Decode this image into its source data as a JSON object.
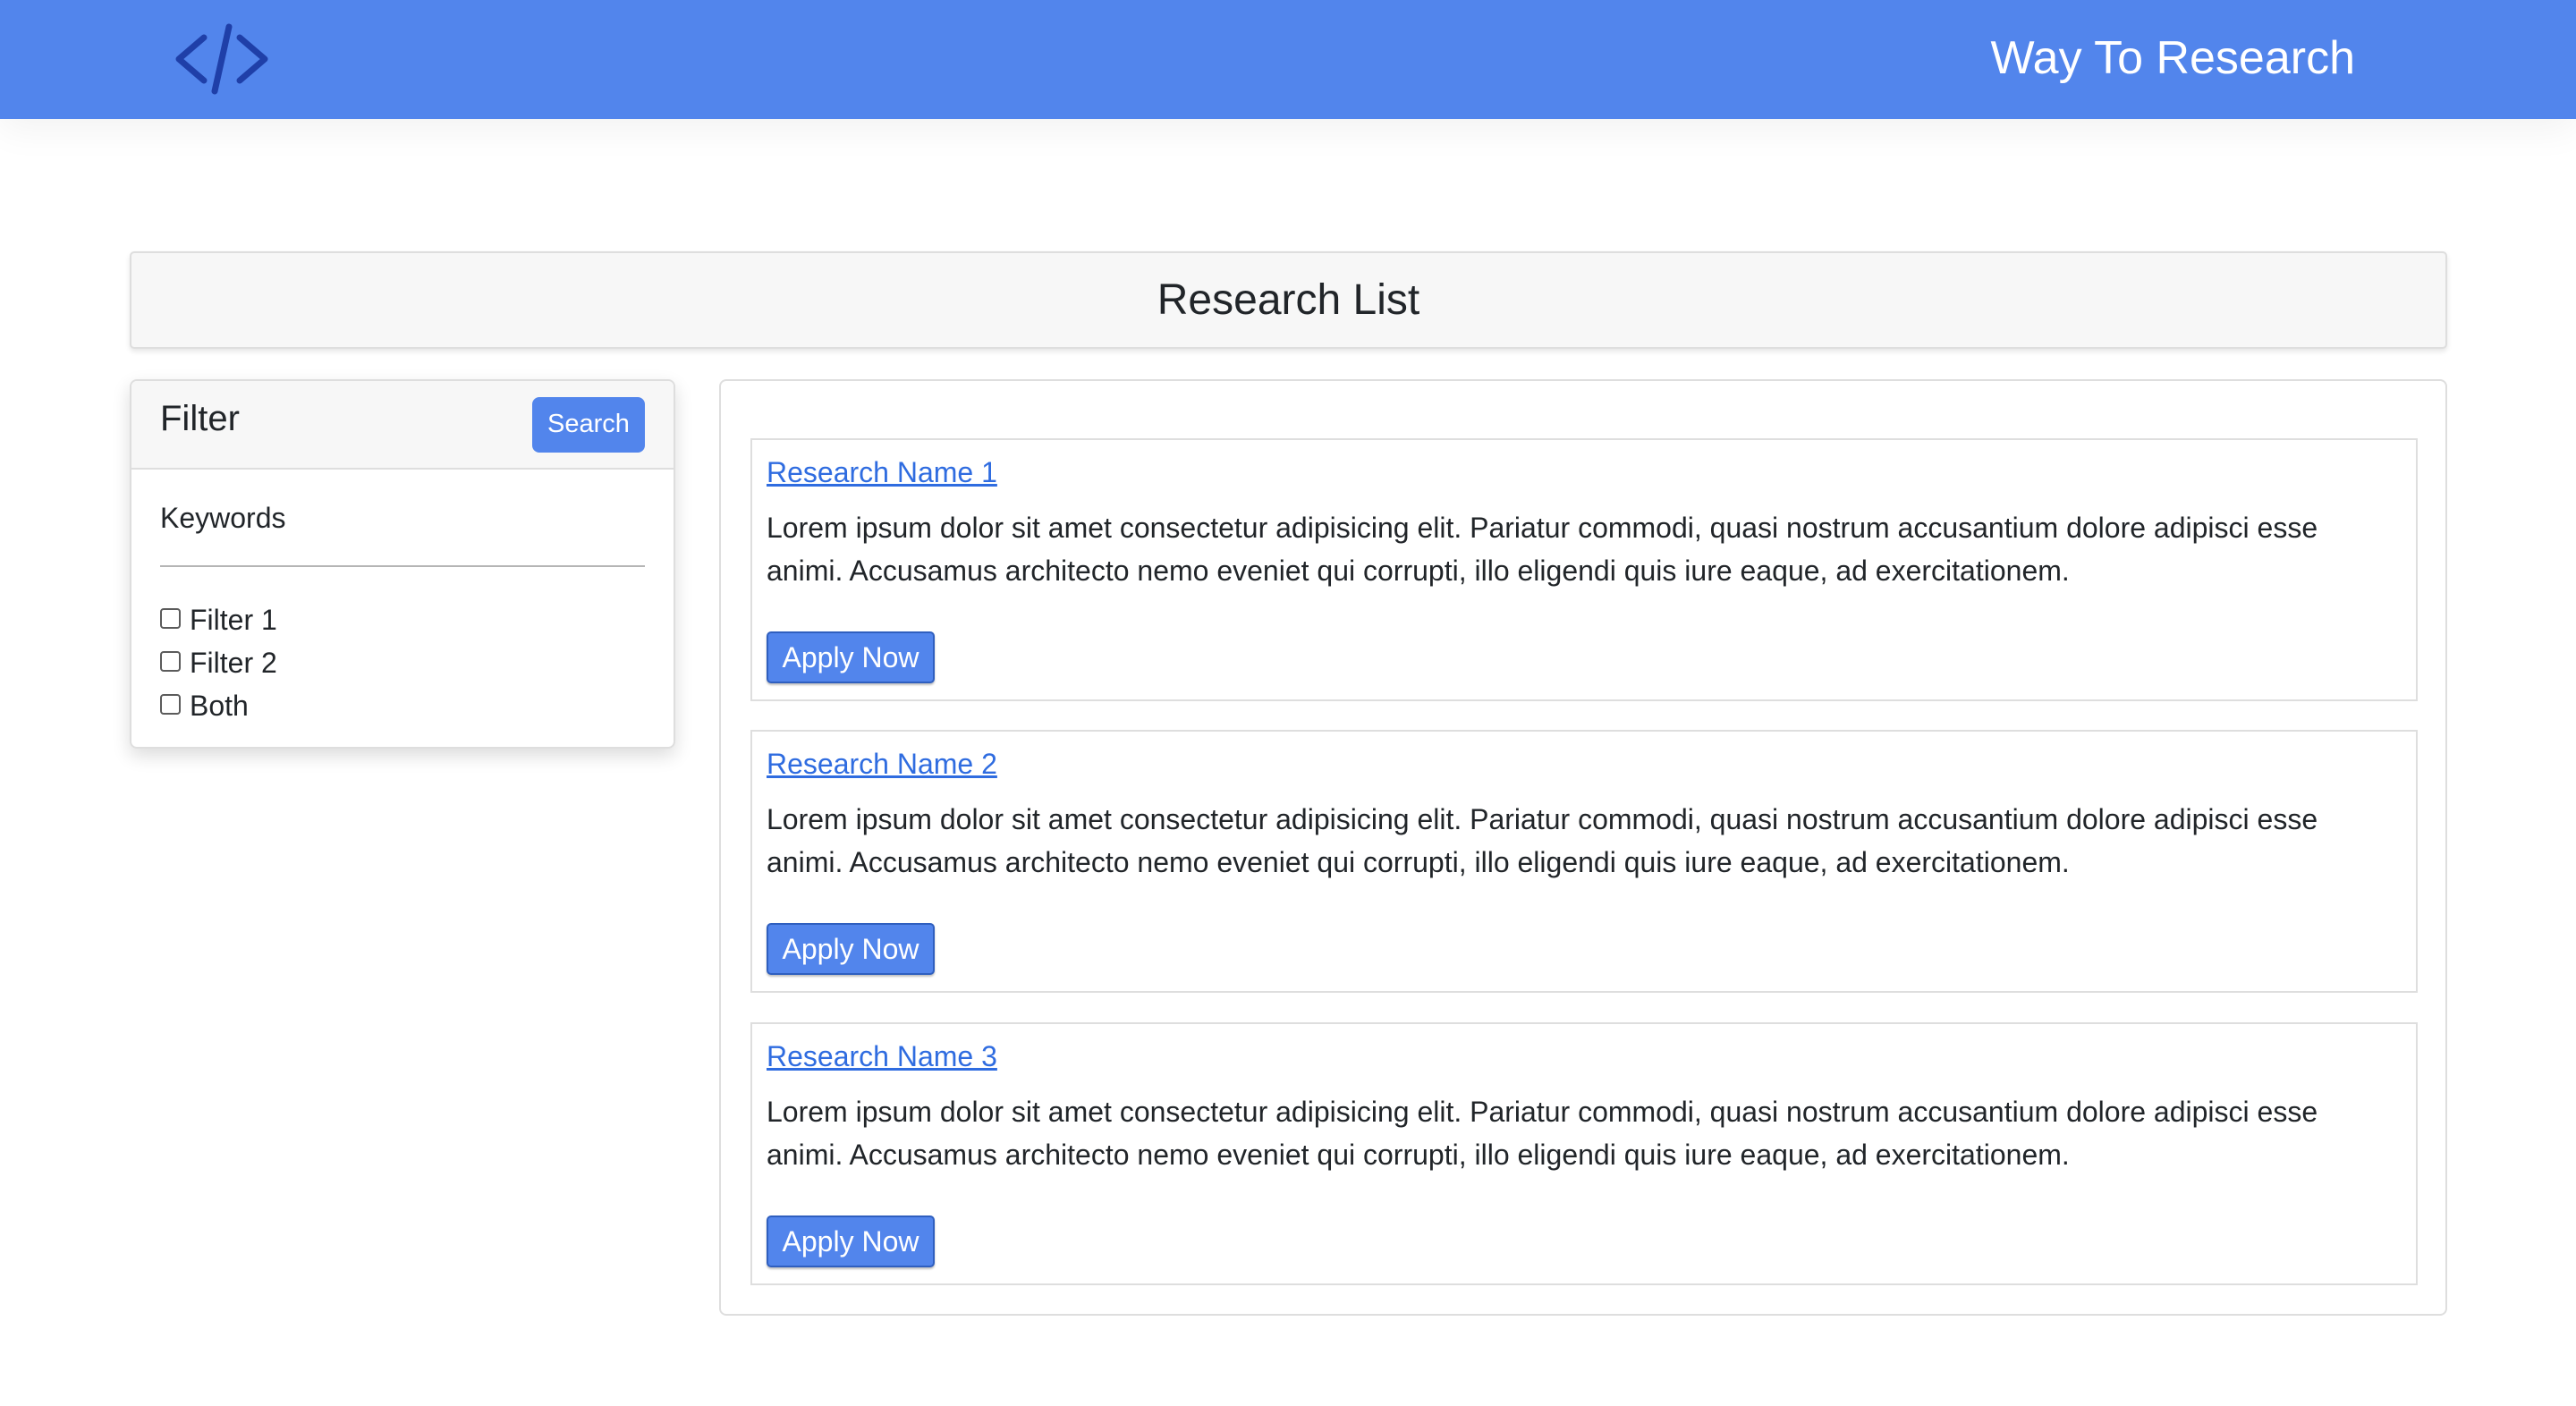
{
  "header": {
    "logo_icon": "code-icon",
    "brand": "Way To Research",
    "colors": {
      "background": "#5285ec",
      "logo": "#1f3fa8",
      "text": "#ffffff"
    }
  },
  "page": {
    "title": "Research List"
  },
  "filter": {
    "title": "Filter",
    "search_label": "Search",
    "keywords_label": "Keywords",
    "options": [
      {
        "label": "Filter 1",
        "checked": false
      },
      {
        "label": "Filter 2",
        "checked": false
      },
      {
        "label": "Both",
        "checked": false
      }
    ]
  },
  "results": [
    {
      "name": "Research Name 1",
      "description": "Lorem ipsum dolor sit amet consectetur adipisicing elit. Pariatur commodi, quasi nostrum accusantium dolore adipisci esse animi. Accusamus architecto nemo eveniet qui corrupti, illo eligendi quis iure eaque, ad exercitationem.",
      "apply_label": "Apply Now"
    },
    {
      "name": "Research Name 2",
      "description": "Lorem ipsum dolor sit amet consectetur adipisicing elit. Pariatur commodi, quasi nostrum accusantium dolore adipisci esse animi. Accusamus architecto nemo eveniet qui corrupti, illo eligendi quis iure eaque, ad exercitationem.",
      "apply_label": "Apply Now"
    },
    {
      "name": "Research Name 3",
      "description": "Lorem ipsum dolor sit amet consectetur adipisicing elit. Pariatur commodi, quasi nostrum accusantium dolore adipisci esse animi. Accusamus architecto nemo eveniet qui corrupti, illo eligendi quis iure eaque, ad exercitationem.",
      "apply_label": "Apply Now"
    }
  ]
}
